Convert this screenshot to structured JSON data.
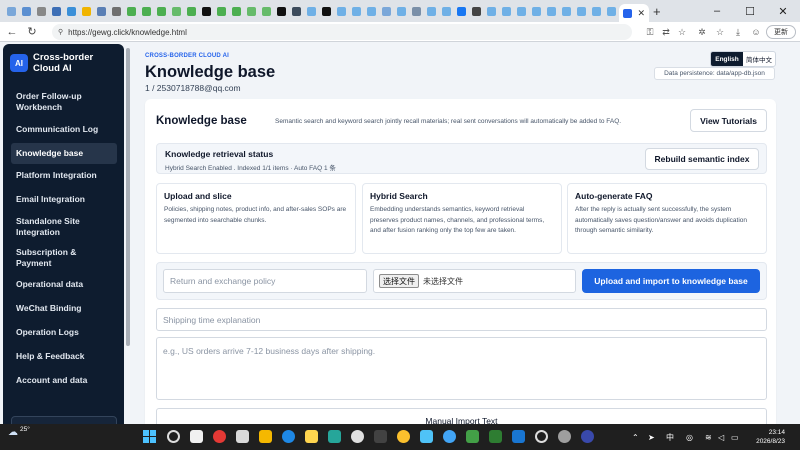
{
  "browser": {
    "url": "https://gewg.click/knowledge.html",
    "update_label": "更新",
    "tab_close": "✕",
    "new_tab": "+"
  },
  "sidebar": {
    "logo": "AI",
    "brand": "Cross-border Cloud AI",
    "items": [
      {
        "label": "Order Follow-up Workbench"
      },
      {
        "label": "Communication Log"
      },
      {
        "label": "Knowledge base"
      },
      {
        "label": "Platform Integration"
      },
      {
        "label": "Email Integration"
      },
      {
        "label": "Standalone Site Integration"
      },
      {
        "label": "Subscription & Payment"
      },
      {
        "label": "Operational data"
      },
      {
        "label": "WeChat Binding"
      },
      {
        "label": "Operation Logs"
      },
      {
        "label": "Help & Feedback"
      },
      {
        "label": "Account and data"
      }
    ],
    "active_index": 2
  },
  "header": {
    "eyebrow": "CROSS-BORDER CLOUD AI",
    "title": "Knowledge base",
    "user": "1 / 2530718788@qq.com",
    "lang_english": "English",
    "lang_chinese": "简体中文",
    "persistence": "Data persistence: data/app-db.json"
  },
  "kb": {
    "title": "Knowledge base",
    "description": "Semantic search and keyword search jointly recall materials; real sent conversations will automatically be added to FAQ.",
    "tutorials_label": "View Tutorials",
    "status_title": "Knowledge retrieval status",
    "status_text": "Hybrid Search Enabled . Indexed 1/1 items · Auto FAQ 1 条",
    "rebuild_label": "Rebuild semantic index",
    "features": [
      {
        "title": "Upload and slice",
        "text": "Policies, shipping notes, product info, and after-sales SOPs are segmented into searchable chunks."
      },
      {
        "title": "Hybrid Search",
        "text": "Embedding understands semantics, keyword retrieval preserves product names, channels, and professional terms, and after fusion ranking only the top few are taken."
      },
      {
        "title": "Auto-generate FAQ",
        "text": "After the reply is actually sent successfully, the system automatically saves question/answer and avoids duplication through semantic similarity."
      }
    ],
    "upload_title_placeholder": "Return and exchange policy",
    "file_button": "选择文件",
    "file_status": "未选择文件",
    "upload_button": "Upload and import to knowledge base",
    "manual_title_placeholder": "Shipping time explanation",
    "manual_content_placeholder": "e.g., US orders arrive 7-12 business days after shipping.",
    "manual_import_label": "Manual Import Text"
  },
  "taskbar": {
    "temperature": "25°",
    "ime": "中",
    "time": "23:14",
    "date": "2026/8/23"
  },
  "colors": {
    "sidebar_bg": "#0e1c2f",
    "accent": "#2563eb",
    "primary_button": "#1d64e0",
    "page_bg": "#f1f4f8"
  }
}
